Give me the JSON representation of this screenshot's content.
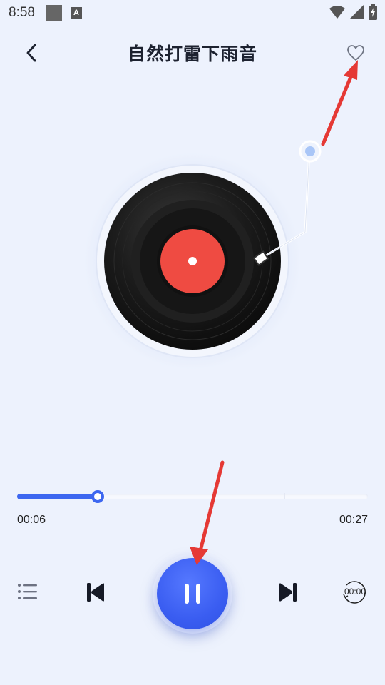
{
  "status_bar": {
    "time": "8:58",
    "icons": [
      "notification-square-icon",
      "a-badge-icon",
      "wifi-icon",
      "signal-icon",
      "battery-icon"
    ]
  },
  "header": {
    "title": "自然打雷下雨音",
    "back_icon": "chevron-left-icon",
    "favorite_icon": "heart-outline-icon"
  },
  "player": {
    "current_time": "00:06",
    "total_time": "00:27",
    "progress": 0.23,
    "state": "playing"
  },
  "controls": {
    "playlist_icon": "playlist-icon",
    "prev_icon": "skip-previous-icon",
    "pause_icon": "pause-icon",
    "next_icon": "skip-next-icon",
    "timer_label": "00:00"
  },
  "colors": {
    "background": "#edf2fd",
    "accent": "#3d67f0",
    "record_label": "#ef4b42",
    "annotation_arrow": "#e53935"
  }
}
